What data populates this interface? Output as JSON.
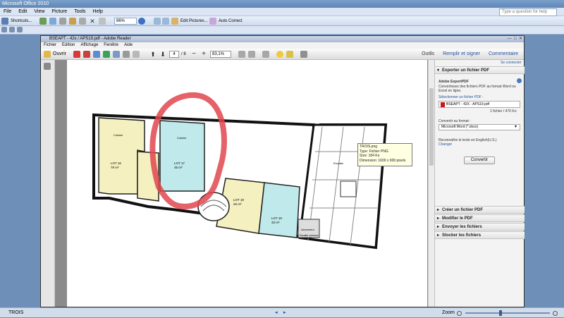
{
  "outer": {
    "title": "Microsoft Office 2010",
    "menu": [
      "File",
      "Edit",
      "View",
      "Picture",
      "Tools",
      "Help"
    ],
    "help_placeholder": "Type a question for help",
    "toolbar": {
      "shortcuts": "Shortcuts...",
      "zoom": "86%",
      "edit_pictures": "Edit Pictures...",
      "auto_correct": "Auto Correct"
    },
    "status_left": "TROIS",
    "zoom_label": "Zoom"
  },
  "acrobat": {
    "title": "BSEAPT - 42x / APS19.pdf - Adobe Reader",
    "menu": [
      "Fichier",
      "Edition",
      "Affichage",
      "Fenêtre",
      "Aide"
    ],
    "open_label": "Ouvrir",
    "page_current": "4",
    "page_total": "/ 8",
    "zoom": "83,1%",
    "tabs": [
      "Outils",
      "Remplir et signer",
      "Commentaire"
    ]
  },
  "panel": {
    "login": "Se connecter",
    "export_header": "Exporter un fichier PDF",
    "service": "Adobe ExportPDF",
    "desc": "Convertissez des fichiers PDF au format Word ou Excel en ligne.",
    "select_link": "Sélectionner un fichier PDF :",
    "file": "BSEAPT - 42X - APS19.pdf",
    "file_meta": "1 fichier / 470 Ko",
    "convert_to": "Convertir au format :",
    "format": "Microsoft Word (*.docx)",
    "recognize": "Reconnaître le texte en English(U.S.)",
    "change": "Changer",
    "convert_btn": "Convertir",
    "sections": [
      "Créer un fichier PDF",
      "Modifier le PDF",
      "Envoyer les fichiers",
      "Stocker les fichiers"
    ]
  },
  "tooltip": {
    "name": "TROIS.png",
    "type": "Type: Fichier PNG",
    "size": "Size: 184 Ko",
    "dims": "Dimension: 1600 x 900 pixels"
  },
  "plan": {
    "lot16": "LOT 16",
    "lot16_area": "79 m²",
    "lot17": "LOT 17",
    "lot17_area": "45 m²",
    "lot18": "LOT 18",
    "lot18_area": "26 m²",
    "lot19": "LOT 19",
    "lot19_area": "33 m²",
    "cuisine1": "Cuisine",
    "cuisine2": "Cuisine",
    "escalier": "Escalier",
    "ascenseur": "Ascenseur",
    "stair_label": "Escalier commun"
  }
}
